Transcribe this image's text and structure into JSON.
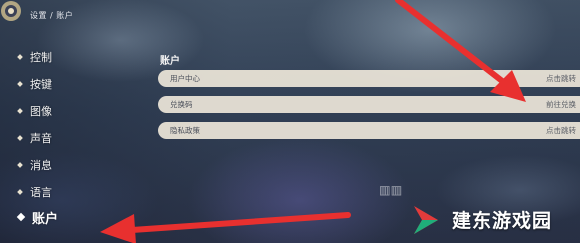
{
  "breadcrumb": "设置 / 账户",
  "sidebar": {
    "items": [
      {
        "label": "控制",
        "active": false
      },
      {
        "label": "按键",
        "active": false
      },
      {
        "label": "图像",
        "active": false
      },
      {
        "label": "声音",
        "active": false
      },
      {
        "label": "消息",
        "active": false
      },
      {
        "label": "语言",
        "active": false
      },
      {
        "label": "账户",
        "active": true
      }
    ]
  },
  "main": {
    "section_title": "账户",
    "rows": [
      {
        "label": "用户中心",
        "action": "点击跳转"
      },
      {
        "label": "兑换码",
        "action": "前往兑换"
      },
      {
        "label": "隐私政策",
        "action": "点击跳转"
      }
    ]
  },
  "watermark": {
    "text": "建东游戏园"
  },
  "colors": {
    "arrow": "#e8302f",
    "row_bg": "#ece5d8",
    "logo_red": "#e23b3b",
    "logo_green": "#1fae7a"
  }
}
